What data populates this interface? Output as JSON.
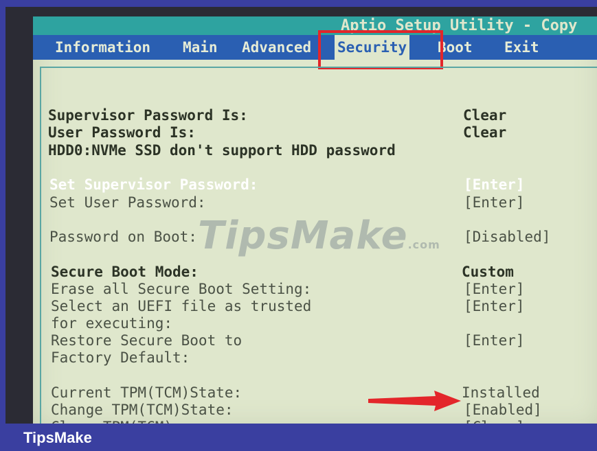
{
  "title": "Aptio Setup Utility - Copy",
  "tabs": [
    {
      "label": "Information"
    },
    {
      "label": "Main"
    },
    {
      "label": "Advanced"
    },
    {
      "label": "Security"
    },
    {
      "label": "Boot"
    },
    {
      "label": "Exit"
    }
  ],
  "active_tab": "Security",
  "rows": {
    "supervisor_pw_label": "Supervisor Password Is:",
    "supervisor_pw_value": "Clear",
    "user_pw_label": "User Password Is:",
    "user_pw_value": "Clear",
    "hdd_note": "HDD0:NVMe SSD don't support HDD password",
    "set_supervisor_label": "Set Supervisor Password:",
    "set_supervisor_value": "[Enter]",
    "set_user_label": "Set User Password:",
    "set_user_value": "[Enter]",
    "pw_on_boot_label": "Password on Boot:",
    "pw_on_boot_value": "[Disabled]",
    "secure_boot_mode_label": "Secure Boot Mode:",
    "secure_boot_mode_value": "Custom",
    "erase_label": "Erase all Secure Boot Setting:",
    "erase_value": "[Enter]",
    "uefi_label_1": "Select an UEFI file as trusted",
    "uefi_label_2": "for executing:",
    "uefi_value": "[Enter]",
    "restore_label_1": "Restore Secure Boot to",
    "restore_label_2": "Factory Default:",
    "restore_value": "[Enter]",
    "current_tpm_label": "Current TPM(TCM)State:",
    "current_tpm_value": "Installed",
    "change_tpm_label": "Change TPM(TCM)State:",
    "change_tpm_value": "[Enabled]",
    "clear_tpm_label": "Clear TPM(TCM):",
    "clear_tpm_value": "[Clear]"
  },
  "watermark": {
    "main": "TipsMake",
    "suffix": ".com"
  },
  "brand": "TipsMake",
  "colors": {
    "screen_bg": "#dfe7cc",
    "tab_bar": "#2a5fb2",
    "title_bar": "#2ea3a0",
    "highlight": "#e3262a",
    "frame": "#3a3fa0"
  }
}
